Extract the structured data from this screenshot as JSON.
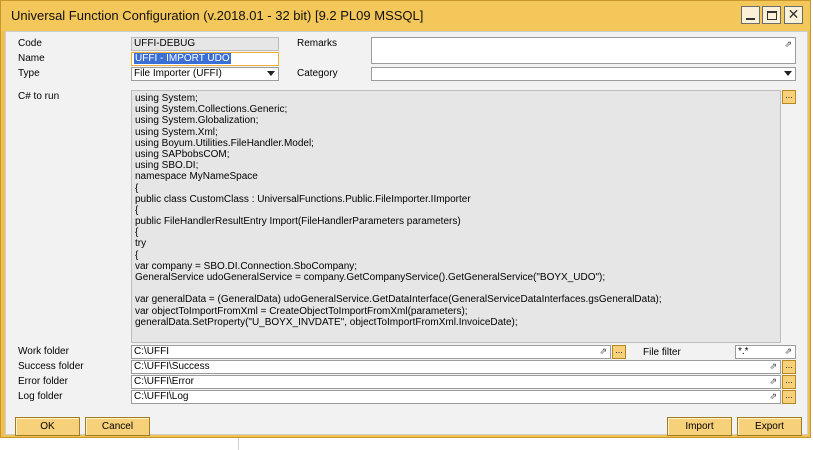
{
  "window": {
    "title": "Universal Function Configuration (v.2018.01 - 32 bit) [9.2 PL09 MSSQL]"
  },
  "form": {
    "code_label": "Code",
    "code_value": "UFFI-DEBUG",
    "name_label": "Name",
    "name_value": "UFFI - IMPORT UDO",
    "type_label": "Type",
    "type_value": "File Importer (UFFI)",
    "remarks_label": "Remarks",
    "remarks_value": "",
    "category_label": "Category",
    "category_value": "",
    "csharp_label": "C# to run",
    "code_lines": [
      "using System;",
      "using System.Collections.Generic;",
      "using System.Globalization;",
      "using System.Xml;",
      "using Boyum.Utilities.FileHandler.Model;",
      "using SAPbobsCOM;",
      "using SBO.DI;",
      "namespace MyNameSpace",
      "{",
      "public class CustomClass : UniversalFunctions.Public.FileImporter.IImporter",
      "{",
      "public FileHandlerResultEntry Import(FileHandlerParameters parameters)",
      "{",
      "try",
      "{",
      "var company = SBO.DI.Connection.SboCompany;",
      "GeneralService udoGeneralService = company.GetCompanyService().GetGeneralService(\"BOYX_UDO\");",
      "",
      "var generalData = (GeneralData) udoGeneralService.GetDataInterface(GeneralServiceDataInterfaces.gsGeneralData);",
      "var objectToImportFromXml = CreateObjectToImportFromXml(parameters);",
      "generalData.SetProperty(\"U_BOYX_INVDATE\", objectToImportFromXml.InvoiceDate);"
    ],
    "work_folder_label": "Work folder",
    "work_folder_value": "C:\\UFFI",
    "file_filter_label": "File filter",
    "file_filter_value": "*.*",
    "success_folder_label": "Success folder",
    "success_folder_value": "C:\\UFFI\\Success",
    "error_folder_label": "Error folder",
    "error_folder_value": "C:\\UFFI\\Error",
    "log_folder_label": "Log folder",
    "log_folder_value": "C:\\UFFI\\Log"
  },
  "buttons": {
    "ok": "OK",
    "cancel": "Cancel",
    "import": "Import",
    "export": "Export",
    "dots": "..."
  },
  "icons": {
    "link": "link-arrow-icon"
  },
  "colors": {
    "accent": "#f0c050",
    "selection": "#3b6fd8"
  }
}
